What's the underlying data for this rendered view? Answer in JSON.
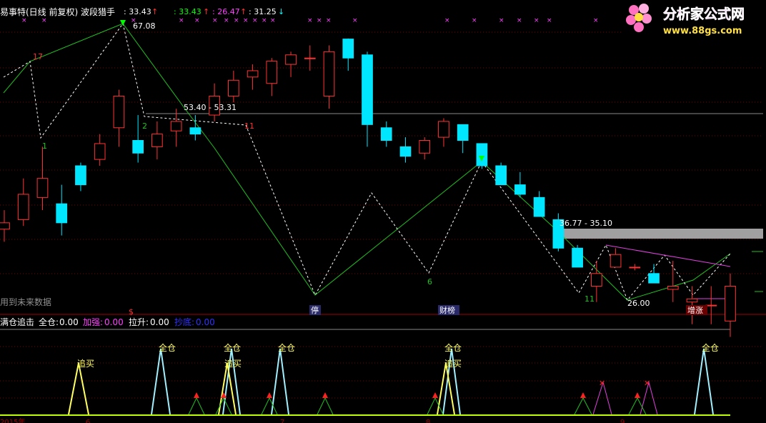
{
  "upper": {
    "title": "易事特(日线 前复权) 波段猎手",
    "readouts": [
      {
        "label": ": 33.43",
        "arrow": "↑",
        "color": "#ffffff",
        "arrow_color": "#ff3030"
      },
      {
        "label": ": 33.43",
        "arrow": "↑",
        "color": "#00ff00",
        "arrow_color": "#ff3030"
      },
      {
        "label": ": 26.47",
        "arrow": "↑",
        "color": "#ff40ff",
        "arrow_color": "#ff3030"
      },
      {
        "label": ": 31.25",
        "arrow": "↓",
        "color": "#00ffff",
        "arrow_color": "#00ffff"
      }
    ],
    "future_data_label": "用到未来数据",
    "annotations": {
      "high": "67.08",
      "range1": "53.40 - 53.31",
      "range2": "36.77 - 35.10",
      "low": "26.00",
      "wave_labels": [
        "17",
        "1",
        "2",
        "11",
        "6",
        "11"
      ],
      "pattern_tags": [
        "停",
        "财榜",
        "增涨"
      ],
      "dollar": "$"
    }
  },
  "lower": {
    "title": "满仓追击",
    "readouts": [
      {
        "label": "全仓:",
        "value": "0.00",
        "color": "#ffffff"
      },
      {
        "label": "加强:",
        "value": "0.00",
        "color": "#ff40ff"
      },
      {
        "label": "拉升:",
        "value": "0.00",
        "color": "#ffffff"
      },
      {
        "label": "抄底:",
        "value": "0.00",
        "color": "#3030ff"
      }
    ],
    "signal_words": {
      "full": "全仓",
      "chase": "追买"
    },
    "axis_dates": [
      "2015年",
      "6",
      "7",
      "8",
      "9"
    ]
  },
  "logo": {
    "title": "分析家公式网",
    "url": "www.88gs.com"
  },
  "colors": {
    "up": "#ff3232",
    "down": "#00e6ff",
    "zigzag_solid": "#20c020",
    "zigzag_dash": "#ffffff",
    "ref_line": "#888888",
    "magenta": "#e040e0",
    "baseline": "#c0ff00"
  },
  "chart_data": [
    {
      "type": "candlestick",
      "title": "易事特(日线 前复权) 波段猎手",
      "ylim": [
        24,
        70
      ],
      "candles": [
        {
          "o": 37.0,
          "h": 40.0,
          "l": 35.0,
          "c": 38.0
        },
        {
          "o": 38.5,
          "h": 45.0,
          "l": 37.5,
          "c": 42.5
        },
        {
          "o": 42.0,
          "h": 50.0,
          "l": 40.0,
          "c": 45.0
        },
        {
          "o": 41.0,
          "h": 44.0,
          "l": 36.0,
          "c": 38.0
        },
        {
          "o": 47.0,
          "h": 47.5,
          "l": 43.0,
          "c": 44.0
        },
        {
          "o": 48.0,
          "h": 52.0,
          "l": 47.0,
          "c": 50.5
        },
        {
          "o": 53.0,
          "h": 59.0,
          "l": 50.0,
          "c": 58.0
        },
        {
          "o": 51.0,
          "h": 55.0,
          "l": 47.5,
          "c": 49.0
        },
        {
          "o": 50.0,
          "h": 54.0,
          "l": 48.0,
          "c": 52.0
        },
        {
          "o": 52.5,
          "h": 56.0,
          "l": 50.0,
          "c": 54.0
        },
        {
          "o": 53.0,
          "h": 55.0,
          "l": 51.0,
          "c": 52.0
        },
        {
          "o": 55.0,
          "h": 60.0,
          "l": 54.0,
          "c": 58.0
        },
        {
          "o": 58.0,
          "h": 62.0,
          "l": 57.0,
          "c": 60.5
        },
        {
          "o": 61.0,
          "h": 63.0,
          "l": 59.0,
          "c": 62.0
        },
        {
          "o": 60.0,
          "h": 64.0,
          "l": 58.0,
          "c": 63.5
        },
        {
          "o": 63.0,
          "h": 65.0,
          "l": 61.0,
          "c": 64.5
        },
        {
          "o": 64.0,
          "h": 66.0,
          "l": 62.0,
          "c": 64.0
        },
        {
          "o": 58.0,
          "h": 66.0,
          "l": 56.0,
          "c": 65.0
        },
        {
          "o": 67.0,
          "h": 67.08,
          "l": 62.0,
          "c": 64.0
        },
        {
          "o": 64.5,
          "h": 65.0,
          "l": 50.0,
          "c": 53.5
        },
        {
          "o": 53.0,
          "h": 54.0,
          "l": 50.0,
          "c": 51.0
        },
        {
          "o": 50.0,
          "h": 51.5,
          "l": 47.5,
          "c": 48.5
        },
        {
          "o": 49.0,
          "h": 51.5,
          "l": 48.0,
          "c": 51.0
        },
        {
          "o": 51.5,
          "h": 54.5,
          "l": 50.0,
          "c": 54.0
        },
        {
          "o": 53.5,
          "h": 53.5,
          "l": 49.0,
          "c": 51.0
        },
        {
          "o": 50.5,
          "h": 50.5,
          "l": 46.5,
          "c": 47.0
        },
        {
          "o": 47.0,
          "h": 47.5,
          "l": 44.0,
          "c": 44.0
        },
        {
          "o": 44.0,
          "h": 46.0,
          "l": 42.0,
          "c": 42.5
        },
        {
          "o": 42.0,
          "h": 43.0,
          "l": 39.0,
          "c": 39.0
        },
        {
          "o": 38.5,
          "h": 39.5,
          "l": 33.5,
          "c": 34.0
        },
        {
          "o": 34.0,
          "h": 34.5,
          "l": 31.0,
          "c": 31.0
        },
        {
          "o": 28.0,
          "h": 32.0,
          "l": 25.5,
          "c": 30.0
        },
        {
          "o": 31.0,
          "h": 34.0,
          "l": 31.0,
          "c": 33.0
        },
        {
          "o": 31.0,
          "h": 31.5,
          "l": 30.5,
          "c": 31.0
        },
        {
          "o": 30.0,
          "h": 31.5,
          "l": 29.0,
          "c": 28.5
        },
        {
          "o": 27.5,
          "h": 32.0,
          "l": 25.5,
          "c": 28.0
        },
        {
          "o": 25.5,
          "h": 28.0,
          "l": 22.0,
          "c": 26.0
        },
        {
          "o": 25.0,
          "h": 28.0,
          "l": 22.0,
          "c": 25.0
        },
        {
          "o": 22.5,
          "h": 30.0,
          "l": 20.0,
          "c": 28.0
        }
      ]
    },
    {
      "type": "signal",
      "title": "满仓追击",
      "series": [
        {
          "name": "全仓",
          "values": [
            0.0
          ]
        },
        {
          "name": "加强",
          "values": [
            0.0
          ]
        },
        {
          "name": "拉升",
          "values": [
            0.0
          ]
        },
        {
          "name": "抄底",
          "values": [
            0.0
          ]
        }
      ]
    }
  ]
}
